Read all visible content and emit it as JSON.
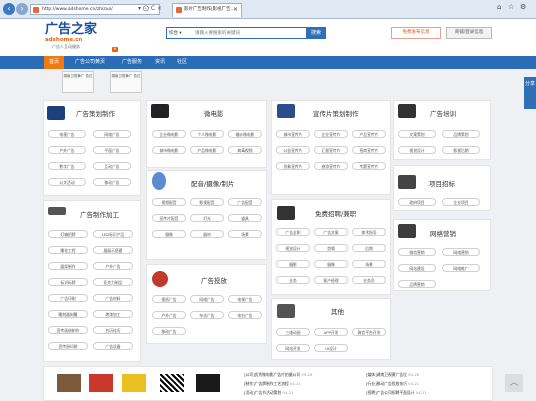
{
  "browser": {
    "url": "http://www.adshome.cn/zhizuo/",
    "tab_title": "影片广告制作|影视广告...",
    "addr_controls": "▾ ⨀ C ×"
  },
  "header": {
    "logo_main": "广告之家",
    "logo_url": "adshome.cn",
    "logo_sub": "广告人互动服务",
    "search_select": "综合 ▾",
    "search_placeholder": "请输入要搜索的关键词",
    "search_button": "搜索",
    "publish_button": "免费发布信息",
    "login_button": "商铺/登录信息"
  },
  "nav": {
    "items": [
      "首页",
      "广告公司黄页",
      "广告服务",
      "资讯",
      "社区"
    ],
    "badge": "H"
  },
  "thumbs": [
    "湖南卫视黄广 告位",
    "湖南卫视黄广 告位"
  ],
  "share": "分享",
  "panels": {
    "p1": {
      "title": "广告策划制作",
      "tags": [
        "电视广告",
        "网络广告",
        "户外广告",
        "平面广告",
        "数字广告",
        "互动广告",
        "公关活动",
        "移动广告"
      ]
    },
    "p2": {
      "title": "微电影",
      "tags": [
        "企业微电影",
        "个人微电影",
        "婚纱微电影",
        "城市微电影",
        "产品微电影",
        "病毒视频"
      ]
    },
    "p3": {
      "title": "宣传片策划制作",
      "tags": [
        "城市宣传片",
        "企业宣传片",
        "产品宣传片",
        "公益宣传片",
        "汇报宣传片",
        "招商宣传片",
        "形象宣传片",
        "旅游宣传片",
        "专题宣传片"
      ]
    },
    "p4": {
      "title": "广告培训",
      "tags": [
        "文案策划",
        "品牌策划",
        "视觉设计",
        "影视后期"
      ]
    },
    "p5": {
      "title": "配音/摄像/制片",
      "tags": [
        "视频配音",
        "影视配音",
        "广告配音",
        "宣传片配音",
        "灯光",
        "道具",
        "摄像",
        "器材",
        "场景"
      ]
    },
    "p6": {
      "title": "项目招标",
      "tags": [
        "政府项目",
        "企业项目"
      ]
    },
    "p7": {
      "title": "广告制作加工",
      "tags": [
        "灯箱招牌",
        "LED标识产品",
        "雕花工程",
        "展展示搭建",
        "展架制作",
        "户外广告",
        "标识标牌",
        "亚克力制品",
        "广告印刷",
        "广告材料",
        "雕刻器刻雕",
        "烤漆加工",
        "宣传画册制作",
        "台历挂历",
        "宣传册印刷",
        "广告设备"
      ]
    },
    "p8": {
      "title": "免费招聘/兼职",
      "tags": [
        "广告全职",
        "广告文案",
        "美术指导",
        "视觉设计",
        "剪辑",
        "后期",
        "摄影",
        "摄像",
        "场景",
        "业务",
        "客户经理",
        "业务员"
      ]
    },
    "p9": {
      "title": "网络营销",
      "tags": [
        "微信营销",
        "网络营销",
        "网站建设",
        "网络推广",
        "品牌营销"
      ]
    },
    "p10": {
      "title": "广告投放",
      "tags": [
        "报纸广告",
        "网络广告",
        "电视广告",
        "户外广告",
        "杂志广告",
        "电台广告",
        "移动广告"
      ]
    },
    "p11": {
      "title": "其他",
      "tags": [
        "三维动画",
        "APP开发",
        "微信平台开发",
        "网站开发",
        "UI设计"
      ]
    }
  },
  "news": [
    {
      "text": "[公司]优秀微电影广告片拍摄公司",
      "date": "05-26"
    },
    {
      "text": "[媒体]湖南卫视黄广告位",
      "date": "04-26"
    },
    {
      "text": "[制作]广告牌制作工艺流程",
      "date": "04-21"
    },
    {
      "text": "[行业]移动广告投放技巧",
      "date": "04-21"
    },
    {
      "text": "[活动]广告节活动策划",
      "date": "04-21"
    },
    {
      "text": "[招聘]广告公司招聘平面设计",
      "date": "04-21"
    }
  ]
}
